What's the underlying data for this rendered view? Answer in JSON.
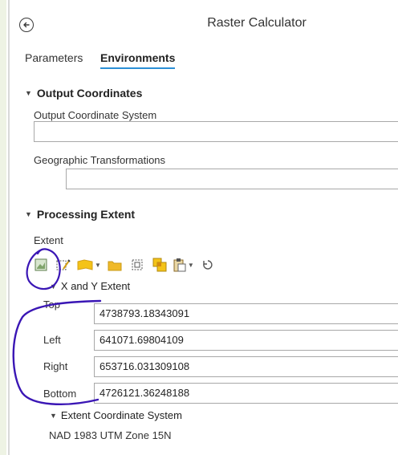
{
  "window": {
    "title": "Raster Calculator"
  },
  "tabs": [
    {
      "label": "Parameters",
      "active": false
    },
    {
      "label": "Environments",
      "active": true
    }
  ],
  "output_coordinates": {
    "header": "Output Coordinates",
    "coordinate_system_label": "Output Coordinate System",
    "coordinate_system_value": "",
    "transformations_label": "Geographic Transformations",
    "transformations_value": ""
  },
  "processing_extent": {
    "header": "Processing Extent",
    "extent_label": "Extent",
    "toolbar_icons": [
      "current-display-extent-icon",
      "draw-extent-icon",
      "layer-extent-icon",
      "browse-folder-icon",
      "clear-extent-icon",
      "intersection-extent-icon",
      "paste-extent-icon",
      "reset-icon"
    ],
    "xy_extent_label": "X and Y Extent",
    "fields": [
      {
        "label": "Top",
        "value": "4738793.18343091"
      },
      {
        "label": "Left",
        "value": "641071.69804109"
      },
      {
        "label": "Right",
        "value": "653716.031309108"
      },
      {
        "label": "Bottom",
        "value": "4726121.36248188"
      }
    ],
    "extent_cs_label": "Extent Coordinate System",
    "extent_cs_value": "NAD 1983 UTM Zone 15N"
  },
  "colors": {
    "accent": "#2b8fd6",
    "annotation": "#3a16b5"
  }
}
